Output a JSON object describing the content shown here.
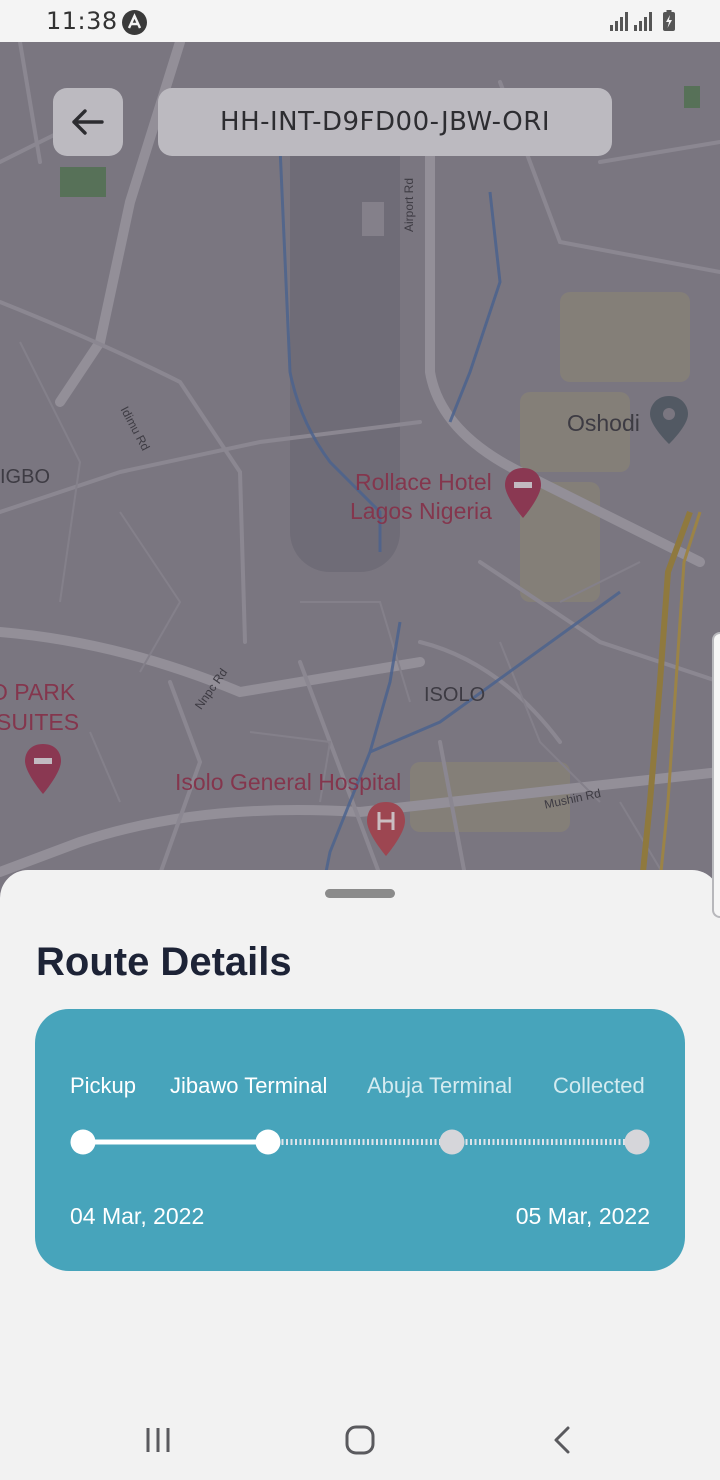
{
  "status_bar": {
    "time": "11:38",
    "icons": [
      "app-notification-icon",
      "signal-icon",
      "signal-icon",
      "battery-charging-icon"
    ]
  },
  "header": {
    "back_icon": "arrow-left-icon",
    "shipment_id": "HH-INT-D9FD00-JBW-ORI"
  },
  "map": {
    "labels": {
      "oshodi": "Oshodi",
      "igbo": "IGBO",
      "hotel_line1": "Rollace Hotel",
      "hotel_line2": "Lagos Nigeria",
      "park_line1": "O PARK",
      "park_line2": "SUITES",
      "isolo": "ISOLO",
      "hospital": "Isolo General Hospital",
      "airport_rd": "Airport Rd",
      "idimu_rd": "Idimu Rd",
      "nnpc_rd": "Nnpc Rd",
      "mushin_rd": "Mushin Rd"
    },
    "markers": [
      "map-pin-icon",
      "hotel-pin-icon",
      "hotel-pin-icon",
      "hospital-pin-icon"
    ]
  },
  "route_details": {
    "title": "Route Details",
    "stops": [
      {
        "label": "Pickup",
        "completed": true
      },
      {
        "label": "Jibawo Terminal",
        "completed": true
      },
      {
        "label": "Abuja Terminal",
        "completed": false
      },
      {
        "label": "Collected",
        "completed": false
      }
    ],
    "start_date": "04 Mar, 2022",
    "end_date": "05 Mar, 2022",
    "colors": {
      "card": "#47a4bb",
      "completed": "#ffffff",
      "pending": "#d6d6da",
      "title": "#1d2336"
    }
  },
  "nav_bar": {
    "icons": [
      "recent-apps-icon",
      "home-icon",
      "back-icon"
    ]
  }
}
